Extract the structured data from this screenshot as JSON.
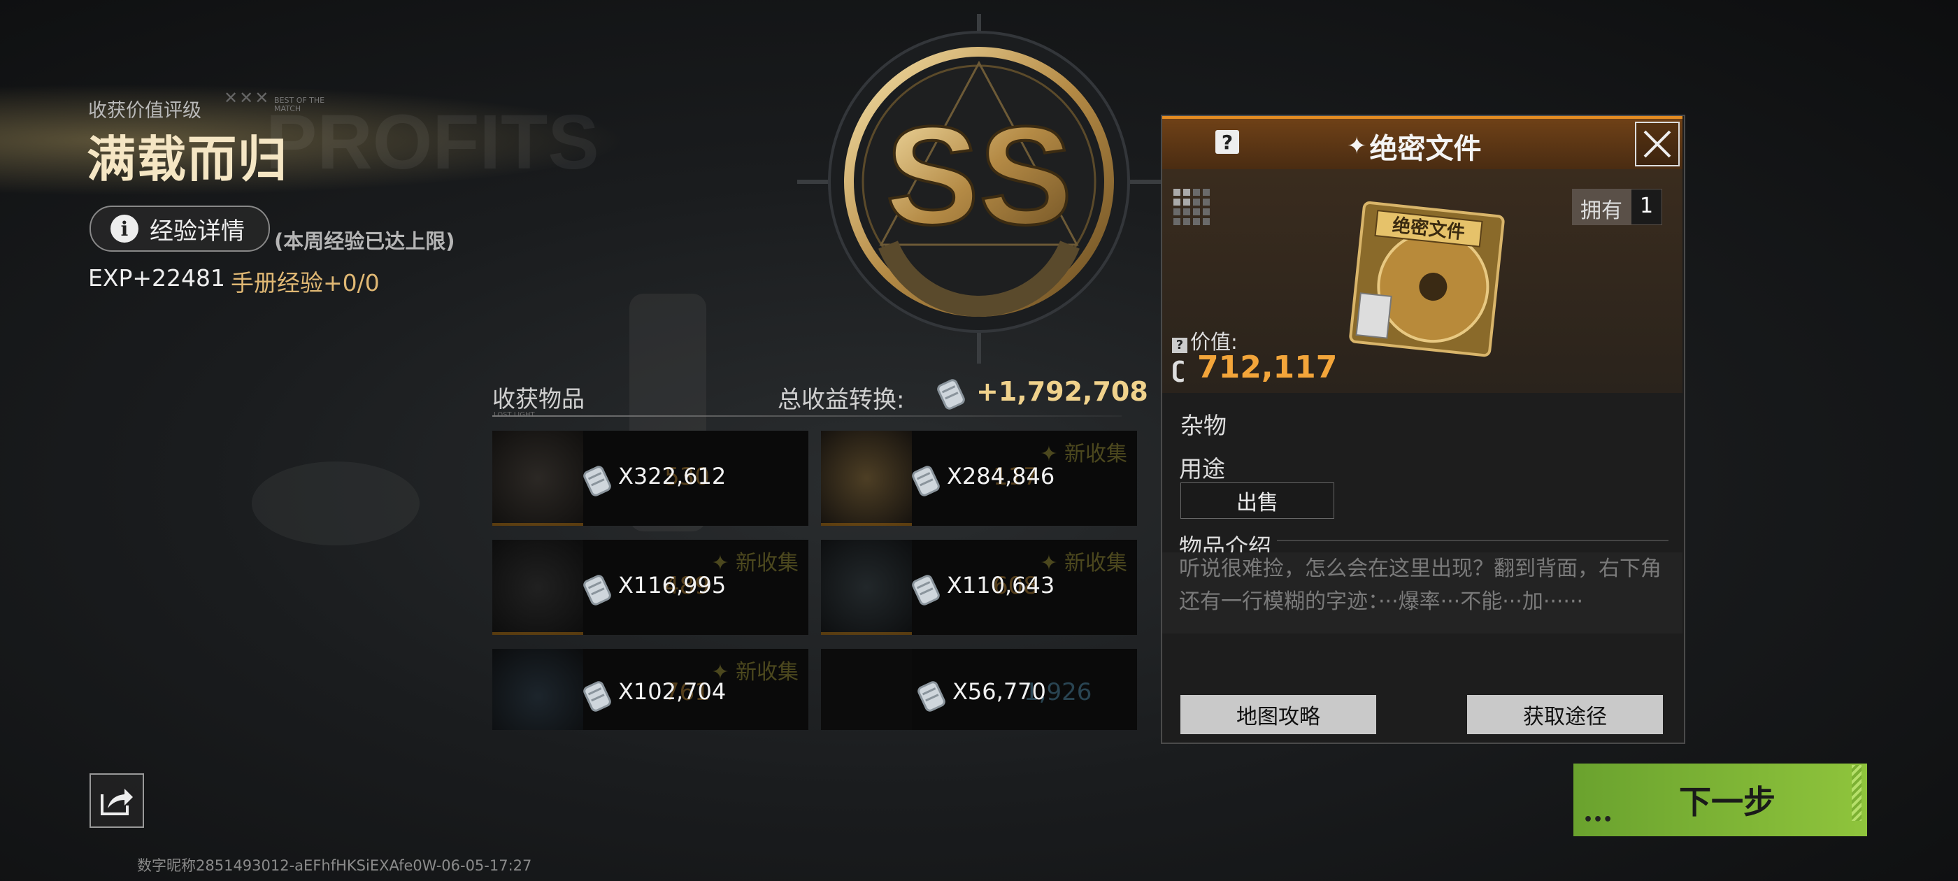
{
  "header": {
    "rating_label": "收获价值评级",
    "best_badge": "BEST OF THE MATCH",
    "rating_title": "满载而归",
    "bg_word": "PROFITS",
    "exp_button": "经验详情",
    "weekly_note": "(本周经验已达上限)",
    "exp_value": "EXP+22481",
    "manual_exp": "手册经验+0/0"
  },
  "emblem": {
    "grade": "SS"
  },
  "items": {
    "title": "收获物品",
    "subtitle": "LOST LIGHT",
    "total_label": "总收益转换:",
    "total_value": "+1,792,708",
    "new_tag": "✦ 新收集",
    "tiles": [
      {
        "qty": "X322,612",
        "ghost": "530",
        "new": false
      },
      {
        "qty": "X284,846",
        "ghost": "117",
        "new": true
      },
      {
        "qty": "X116,995",
        "ghost": "489",
        "new": true
      },
      {
        "qty": "X110,643",
        "ghost": "608",
        "new": true
      },
      {
        "qty": "X102,704",
        "ghost": "761",
        "new": true
      },
      {
        "qty": "X56,770",
        "ghost": "1,926",
        "new": false
      }
    ]
  },
  "detail": {
    "title": "绝密文件",
    "owned_label": "拥有",
    "owned_count": "1",
    "value_label": "价值:",
    "value": "712,117",
    "category": "杂物",
    "usage_label": "用途",
    "sell_button": "出售",
    "intro_label": "物品介绍",
    "description": "听说很难捡，怎么会在这里出现？翻到背面，右下角还有一行模糊的字迹：···爆率···不能···加······",
    "map_button": "地图攻略",
    "source_button": "获取途径",
    "art_text": "绝密文件"
  },
  "footer": {
    "next_button": "下一步",
    "id_text": "数字昵称2851493012-aEFhfHKSiEXAfe0W-06-05-17:27"
  },
  "colors": {
    "accent": "#e38b22",
    "gold": "#f0d28c",
    "value": "#f3a53a",
    "next": "#8fc43c"
  }
}
